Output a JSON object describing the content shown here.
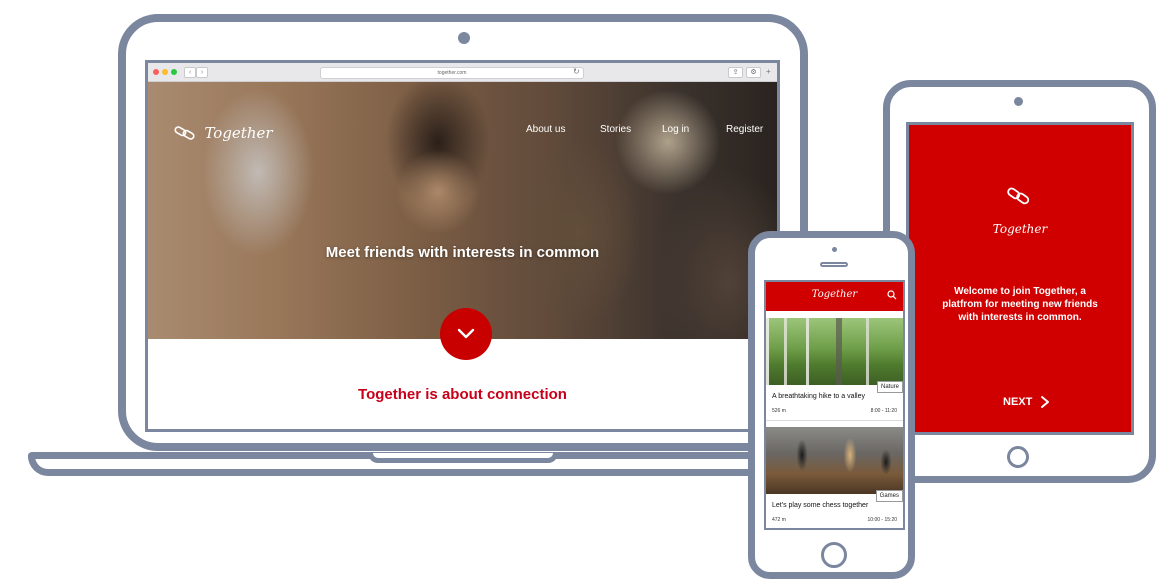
{
  "colors": {
    "brand_red": "#d00000",
    "device_frame": "#7b879f"
  },
  "laptop": {
    "browser": {
      "url": "together.com",
      "icons": [
        "close-dot-icon",
        "minimize-dot-icon",
        "maximize-dot-icon",
        "back-icon",
        "forward-icon",
        "reload-icon",
        "share-icon",
        "settings-icon"
      ]
    },
    "site": {
      "logo_text": "Together",
      "nav": [
        "About us",
        "Stories",
        "Log in",
        "Register"
      ],
      "hero_title": "Meet friends with interests in common",
      "cta_icon": "chevron-down-icon",
      "tagline": "Together is about connection"
    }
  },
  "tablet": {
    "logo_text": "Together",
    "welcome_text": "Welcome to join Together, a platfrom for meeting new friends with interests in common.",
    "next_label": "NEXT",
    "next_icon": "chevron-right-icon"
  },
  "phone": {
    "header_title": "Together",
    "search_icon": "search-icon",
    "cards": [
      {
        "tag": "Nature",
        "title": "A breathtaking hike to a valley",
        "distance": "526 m",
        "time": "8:00 - 11:20"
      },
      {
        "tag": "Games",
        "title": "Let's play some chess together",
        "distance": "472 m",
        "time": "10:00 - 15:20"
      }
    ]
  }
}
